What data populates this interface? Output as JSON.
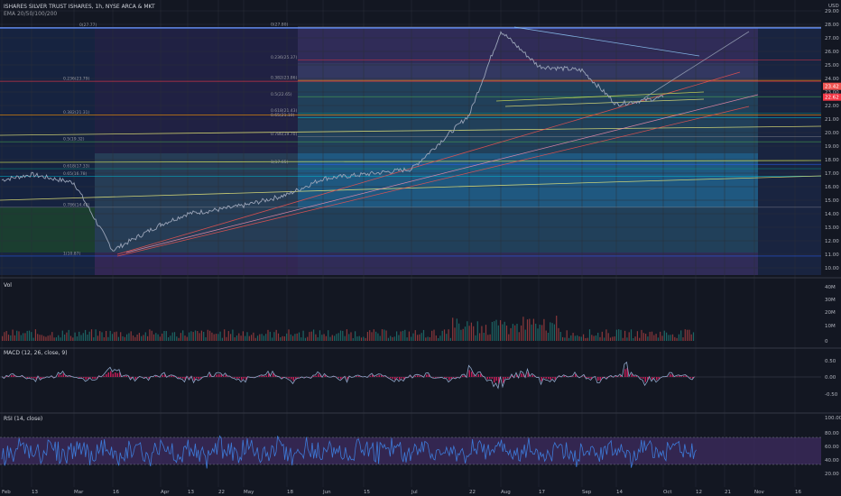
{
  "header": {
    "symbol_line": "ISHARES SILVER TRUST ISHARES, 1h, NYSE ARCA & MKT",
    "ema_line": "EMA 20/50/100/200"
  },
  "price_axis": {
    "currency": "USD",
    "ticks": [
      "29.00",
      "28.00",
      "27.00",
      "26.00",
      "25.00",
      "24.00",
      "23.00",
      "22.00",
      "21.00",
      "20.00",
      "19.00",
      "18.00",
      "17.00",
      "16.00",
      "15.00",
      "14.00",
      "13.00",
      "12.00",
      "11.00",
      "10.00"
    ],
    "price_tags": [
      "23.42",
      "22.62"
    ]
  },
  "time_axis": {
    "labels": [
      "Feb",
      "13",
      "Mar",
      "16",
      "Apr",
      "13",
      "22",
      "May",
      "18",
      "Jun",
      "15",
      "Jul",
      "22",
      "Aug",
      "17",
      "Sep",
      "14",
      "Oct",
      "12",
      "21",
      "Nov",
      "16"
    ]
  },
  "fib_labels": [
    "0(27.77)",
    "0.236(23.79)",
    "0.382(21.31)",
    "0.5(19.32)",
    "0.618(17.33)",
    "0.65(16.78)",
    "0.786(14.48)",
    "1(10.87)",
    "0(27.80)",
    "0.236(25.37)",
    "0.382(23.86)",
    "0.5(22.65)",
    "0.618(21.43)",
    "0.65(21.10)",
    "0.786(19.70)",
    "1(17.65)"
  ],
  "panels": {
    "volume": {
      "title": "Vol",
      "ticks": [
        "40M",
        "30M",
        "20M",
        "10M",
        "0"
      ]
    },
    "macd": {
      "title": "MACD (12, 26, close, 9)",
      "ticks": [
        "0.50",
        "0.00",
        "-0.50"
      ]
    },
    "rsi": {
      "title": "RSI (14, close)",
      "ticks": [
        "100.00",
        "80.00",
        "60.00",
        "40.00",
        "20.00"
      ]
    }
  },
  "colors": {
    "background": "#131722",
    "price_line": "#9aa4b8",
    "volume_up": "#26a69a",
    "volume_down": "#ef5350",
    "macd_line": "#8fa6c9",
    "macd_hist": "#e91e63",
    "rsi_line": "#3d7bd9",
    "rsi_band": "#3c2a5c"
  },
  "chart_data": {
    "type": "line",
    "title": "ISHARES SILVER TRUST ISHARES, 1h, NYSE ARCA & MKT",
    "xlabel": "",
    "ylabel": "USD",
    "ylim": [
      9.5,
      29.2
    ],
    "grid": true,
    "x_labels": [
      "Feb",
      "13",
      "Mar",
      "16",
      "Apr",
      "13",
      "22",
      "May",
      "18",
      "Jun",
      "15",
      "Jul",
      "22",
      "Aug",
      "17",
      "Sep",
      "14",
      "Oct",
      "12",
      "21",
      "Nov",
      "16"
    ],
    "series": [
      {
        "x": [
          "Feb",
          "13",
          "Mar",
          "16",
          "Apr",
          "13",
          "22",
          "May",
          "18",
          "Jun",
          "15",
          "Jul",
          "22",
          "Aug",
          "17",
          "Sep",
          "14",
          "Oct"
        ],
        "values": [
          16.5,
          16.9,
          16.3,
          11.3,
          13.2,
          14.0,
          14.3,
          14.6,
          15.4,
          16.6,
          16.9,
          17.3,
          21.3,
          27.5,
          24.9,
          24.6,
          22.1,
          22.6
        ]
      }
    ],
    "fib_levels_set_1": [
      27.77,
      23.79,
      21.31,
      19.32,
      17.33,
      16.78,
      14.48,
      10.87
    ],
    "fib_levels_set_2": [
      27.8,
      25.37,
      23.86,
      22.65,
      21.43,
      21.1,
      19.7,
      17.65
    ]
  }
}
